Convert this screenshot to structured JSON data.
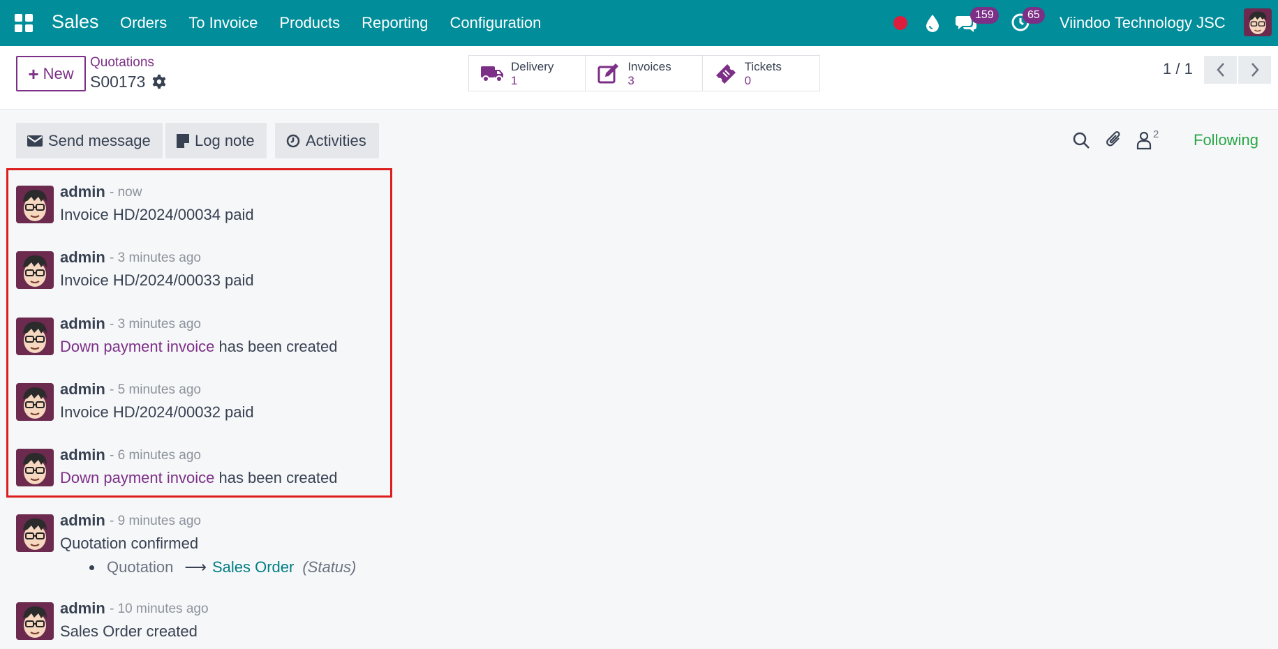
{
  "nav": {
    "app_name": "Sales",
    "menu": [
      "Orders",
      "To Invoice",
      "Products",
      "Reporting",
      "Configuration"
    ],
    "messages_badge": "159",
    "activities_badge": "65",
    "company": "Viindoo Technology JSC",
    "colors": {
      "bar": "#018d9a",
      "badge": "#7c2f86",
      "record": "#dc1e3c"
    }
  },
  "control": {
    "new_label": "New",
    "breadcrumb_parent": "Quotations",
    "breadcrumb_current": "S00173",
    "smart_buttons": [
      {
        "label": "Delivery",
        "value": "1",
        "icon": "truck-icon"
      },
      {
        "label": "Invoices",
        "value": "3",
        "icon": "edit-icon"
      },
      {
        "label": "Tickets",
        "value": "0",
        "icon": "ticket-icon"
      }
    ],
    "pager": "1 / 1"
  },
  "chatter": {
    "send_message": "Send message",
    "log_note": "Log note",
    "activities": "Activities",
    "followers_count": "2",
    "following": "Following",
    "messages": [
      {
        "author": "admin",
        "date": "- now",
        "body": "Invoice HD/2024/00034 paid"
      },
      {
        "author": "admin",
        "date": "- 3 minutes ago",
        "body": "Invoice HD/2024/00033 paid"
      },
      {
        "author": "admin",
        "date": "- 3 minutes ago",
        "link": "Down payment invoice",
        "body": "has been created"
      },
      {
        "author": "admin",
        "date": "- 5 minutes ago",
        "body": "Invoice HD/2024/00032 paid"
      },
      {
        "author": "admin",
        "date": "- 6 minutes ago",
        "link": "Down payment invoice",
        "body": "has been created"
      },
      {
        "author": "admin",
        "date": "- 9 minutes ago",
        "body": "Quotation confirmed",
        "tracking": {
          "old": "Quotation",
          "new": "Sales Order",
          "field": "(Status)"
        }
      },
      {
        "author": "admin",
        "date": "- 10 minutes ago",
        "body": "Sales Order created"
      }
    ]
  }
}
